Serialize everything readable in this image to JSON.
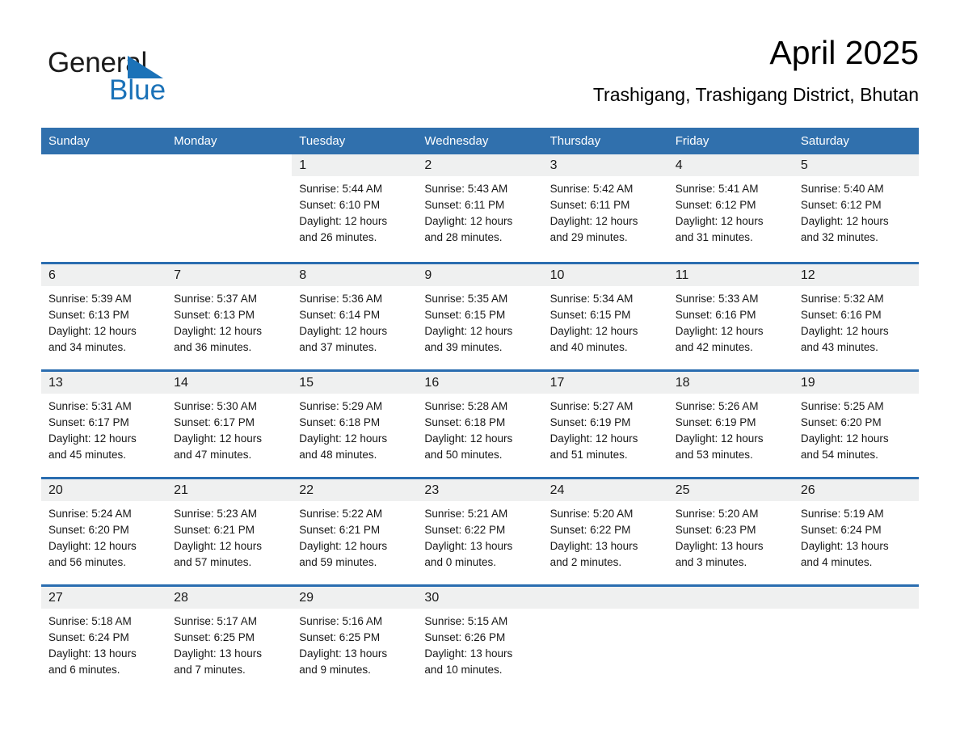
{
  "logo": {
    "word1": "General",
    "word2": "Blue",
    "triangle_color": "#1b72b8"
  },
  "header": {
    "month_title": "April 2025",
    "location": "Trashigang, Trashigang District, Bhutan"
  },
  "theme": {
    "header_blue": "#3070ad",
    "row_separator_blue": "#2a6db0",
    "daynum_band": "#eff0f0"
  },
  "weekdays": [
    "Sunday",
    "Monday",
    "Tuesday",
    "Wednesday",
    "Thursday",
    "Friday",
    "Saturday"
  ],
  "weeks": [
    [
      {
        "day": "",
        "sunrise": "",
        "sunset": "",
        "daylight1": "",
        "daylight2": "",
        "blank": true
      },
      {
        "day": "",
        "sunrise": "",
        "sunset": "",
        "daylight1": "",
        "daylight2": "",
        "blank": true
      },
      {
        "day": "1",
        "sunrise": "Sunrise: 5:44 AM",
        "sunset": "Sunset: 6:10 PM",
        "daylight1": "Daylight: 12 hours",
        "daylight2": "and 26 minutes."
      },
      {
        "day": "2",
        "sunrise": "Sunrise: 5:43 AM",
        "sunset": "Sunset: 6:11 PM",
        "daylight1": "Daylight: 12 hours",
        "daylight2": "and 28 minutes."
      },
      {
        "day": "3",
        "sunrise": "Sunrise: 5:42 AM",
        "sunset": "Sunset: 6:11 PM",
        "daylight1": "Daylight: 12 hours",
        "daylight2": "and 29 minutes."
      },
      {
        "day": "4",
        "sunrise": "Sunrise: 5:41 AM",
        "sunset": "Sunset: 6:12 PM",
        "daylight1": "Daylight: 12 hours",
        "daylight2": "and 31 minutes."
      },
      {
        "day": "5",
        "sunrise": "Sunrise: 5:40 AM",
        "sunset": "Sunset: 6:12 PM",
        "daylight1": "Daylight: 12 hours",
        "daylight2": "and 32 minutes."
      }
    ],
    [
      {
        "day": "6",
        "sunrise": "Sunrise: 5:39 AM",
        "sunset": "Sunset: 6:13 PM",
        "daylight1": "Daylight: 12 hours",
        "daylight2": "and 34 minutes."
      },
      {
        "day": "7",
        "sunrise": "Sunrise: 5:37 AM",
        "sunset": "Sunset: 6:13 PM",
        "daylight1": "Daylight: 12 hours",
        "daylight2": "and 36 minutes."
      },
      {
        "day": "8",
        "sunrise": "Sunrise: 5:36 AM",
        "sunset": "Sunset: 6:14 PM",
        "daylight1": "Daylight: 12 hours",
        "daylight2": "and 37 minutes."
      },
      {
        "day": "9",
        "sunrise": "Sunrise: 5:35 AM",
        "sunset": "Sunset: 6:15 PM",
        "daylight1": "Daylight: 12 hours",
        "daylight2": "and 39 minutes."
      },
      {
        "day": "10",
        "sunrise": "Sunrise: 5:34 AM",
        "sunset": "Sunset: 6:15 PM",
        "daylight1": "Daylight: 12 hours",
        "daylight2": "and 40 minutes."
      },
      {
        "day": "11",
        "sunrise": "Sunrise: 5:33 AM",
        "sunset": "Sunset: 6:16 PM",
        "daylight1": "Daylight: 12 hours",
        "daylight2": "and 42 minutes."
      },
      {
        "day": "12",
        "sunrise": "Sunrise: 5:32 AM",
        "sunset": "Sunset: 6:16 PM",
        "daylight1": "Daylight: 12 hours",
        "daylight2": "and 43 minutes."
      }
    ],
    [
      {
        "day": "13",
        "sunrise": "Sunrise: 5:31 AM",
        "sunset": "Sunset: 6:17 PM",
        "daylight1": "Daylight: 12 hours",
        "daylight2": "and 45 minutes."
      },
      {
        "day": "14",
        "sunrise": "Sunrise: 5:30 AM",
        "sunset": "Sunset: 6:17 PM",
        "daylight1": "Daylight: 12 hours",
        "daylight2": "and 47 minutes."
      },
      {
        "day": "15",
        "sunrise": "Sunrise: 5:29 AM",
        "sunset": "Sunset: 6:18 PM",
        "daylight1": "Daylight: 12 hours",
        "daylight2": "and 48 minutes."
      },
      {
        "day": "16",
        "sunrise": "Sunrise: 5:28 AM",
        "sunset": "Sunset: 6:18 PM",
        "daylight1": "Daylight: 12 hours",
        "daylight2": "and 50 minutes."
      },
      {
        "day": "17",
        "sunrise": "Sunrise: 5:27 AM",
        "sunset": "Sunset: 6:19 PM",
        "daylight1": "Daylight: 12 hours",
        "daylight2": "and 51 minutes."
      },
      {
        "day": "18",
        "sunrise": "Sunrise: 5:26 AM",
        "sunset": "Sunset: 6:19 PM",
        "daylight1": "Daylight: 12 hours",
        "daylight2": "and 53 minutes."
      },
      {
        "day": "19",
        "sunrise": "Sunrise: 5:25 AM",
        "sunset": "Sunset: 6:20 PM",
        "daylight1": "Daylight: 12 hours",
        "daylight2": "and 54 minutes."
      }
    ],
    [
      {
        "day": "20",
        "sunrise": "Sunrise: 5:24 AM",
        "sunset": "Sunset: 6:20 PM",
        "daylight1": "Daylight: 12 hours",
        "daylight2": "and 56 minutes."
      },
      {
        "day": "21",
        "sunrise": "Sunrise: 5:23 AM",
        "sunset": "Sunset: 6:21 PM",
        "daylight1": "Daylight: 12 hours",
        "daylight2": "and 57 minutes."
      },
      {
        "day": "22",
        "sunrise": "Sunrise: 5:22 AM",
        "sunset": "Sunset: 6:21 PM",
        "daylight1": "Daylight: 12 hours",
        "daylight2": "and 59 minutes."
      },
      {
        "day": "23",
        "sunrise": "Sunrise: 5:21 AM",
        "sunset": "Sunset: 6:22 PM",
        "daylight1": "Daylight: 13 hours",
        "daylight2": "and 0 minutes."
      },
      {
        "day": "24",
        "sunrise": "Sunrise: 5:20 AM",
        "sunset": "Sunset: 6:22 PM",
        "daylight1": "Daylight: 13 hours",
        "daylight2": "and 2 minutes."
      },
      {
        "day": "25",
        "sunrise": "Sunrise: 5:20 AM",
        "sunset": "Sunset: 6:23 PM",
        "daylight1": "Daylight: 13 hours",
        "daylight2": "and 3 minutes."
      },
      {
        "day": "26",
        "sunrise": "Sunrise: 5:19 AM",
        "sunset": "Sunset: 6:24 PM",
        "daylight1": "Daylight: 13 hours",
        "daylight2": "and 4 minutes."
      }
    ],
    [
      {
        "day": "27",
        "sunrise": "Sunrise: 5:18 AM",
        "sunset": "Sunset: 6:24 PM",
        "daylight1": "Daylight: 13 hours",
        "daylight2": "and 6 minutes."
      },
      {
        "day": "28",
        "sunrise": "Sunrise: 5:17 AM",
        "sunset": "Sunset: 6:25 PM",
        "daylight1": "Daylight: 13 hours",
        "daylight2": "and 7 minutes."
      },
      {
        "day": "29",
        "sunrise": "Sunrise: 5:16 AM",
        "sunset": "Sunset: 6:25 PM",
        "daylight1": "Daylight: 13 hours",
        "daylight2": "and 9 minutes."
      },
      {
        "day": "30",
        "sunrise": "Sunrise: 5:15 AM",
        "sunset": "Sunset: 6:26 PM",
        "daylight1": "Daylight: 13 hours",
        "daylight2": "and 10 minutes."
      },
      {
        "day": "",
        "sunrise": "",
        "sunset": "",
        "daylight1": "",
        "daylight2": "",
        "empty": true
      },
      {
        "day": "",
        "sunrise": "",
        "sunset": "",
        "daylight1": "",
        "daylight2": "",
        "empty": true
      },
      {
        "day": "",
        "sunrise": "",
        "sunset": "",
        "daylight1": "",
        "daylight2": "",
        "empty": true
      }
    ]
  ]
}
